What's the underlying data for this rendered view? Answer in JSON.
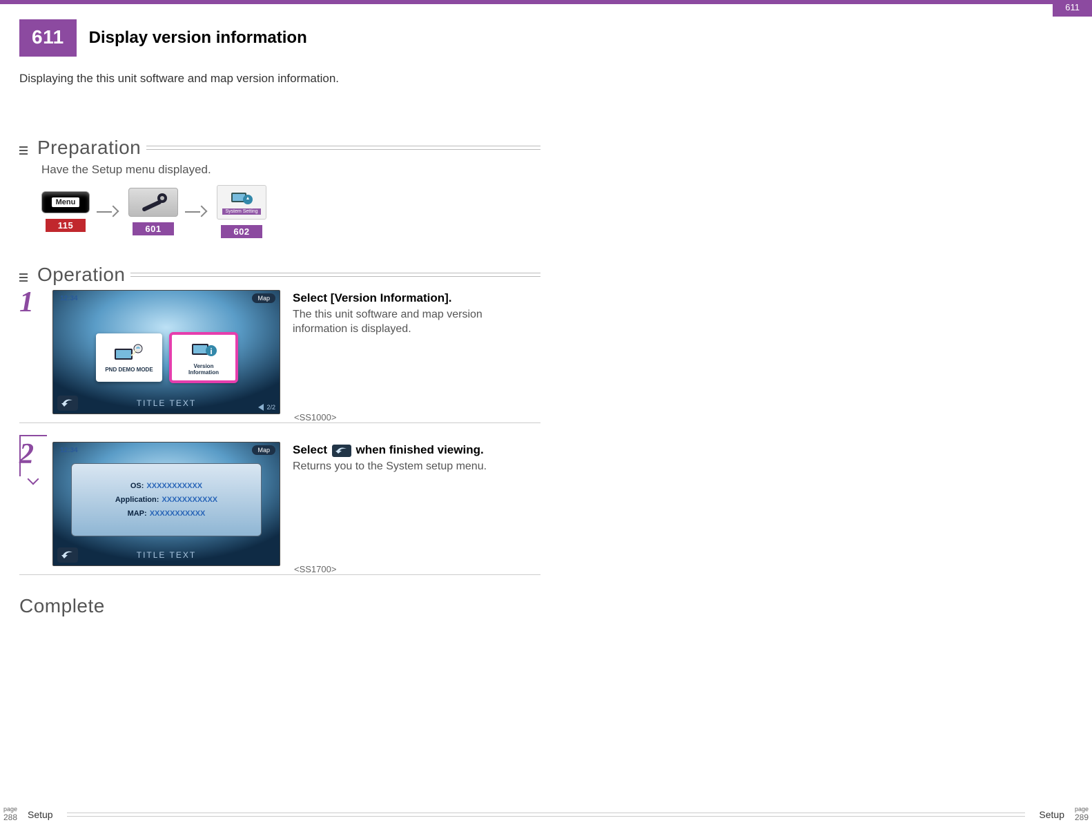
{
  "top_page_number": "611",
  "header": {
    "section_number": "611",
    "title": "Display version information"
  },
  "intro": "Displaying the this unit software and map version information.",
  "prep": {
    "heading": "Preparation",
    "text": "Have the Setup menu displayed.",
    "menu_label": "Menu",
    "sys_label": "System Setting",
    "refs": {
      "a": "115",
      "b": "601",
      "c": "602"
    }
  },
  "op": {
    "heading": "Operation"
  },
  "steps": {
    "s1": {
      "num": "1",
      "instruction": "Select [Version Information].",
      "description": "The this unit software and map version information is displayed.",
      "screen_ref": "<SS1000>",
      "screen": {
        "clock": "12:34",
        "map_btn": "Map",
        "card_a": "PND DEMO MODE",
        "card_b_line1": "Version",
        "card_b_line2": "Information",
        "title": "TITLE TEXT",
        "pager": "2/2"
      }
    },
    "s2": {
      "num": "2",
      "instruction_prefix": "Select ",
      "instruction_suffix": " when finished viewing.",
      "description": "Returns you to the System setup menu.",
      "screen_ref": "<SS1700>",
      "screen": {
        "clock": "12:34",
        "map_btn": "Map",
        "os_k": "OS:",
        "os_v": "XXXXXXXXXXX",
        "app_k": "Application:",
        "app_v": "XXXXXXXXXXX",
        "map_k": "MAP:",
        "map_v": "XXXXXXXXXXX",
        "title": "TITLE TEXT"
      }
    }
  },
  "complete": "Complete",
  "footer": {
    "page_label": "page",
    "left_page": "288",
    "right_page": "289",
    "chapter": "Setup"
  }
}
